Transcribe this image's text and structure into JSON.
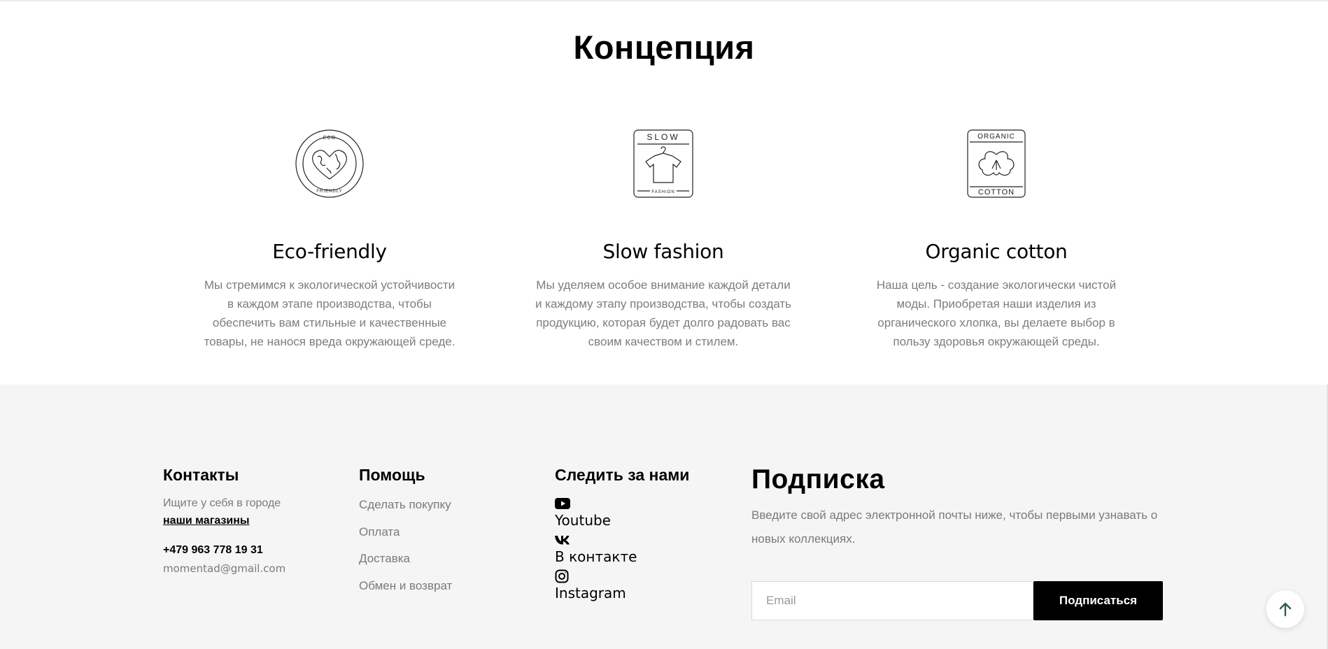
{
  "concept": {
    "title": "Концепция",
    "features": [
      {
        "icon": "eco-friendly-badge",
        "badge_top": "ECO",
        "badge_bottom": "FRIENDLY",
        "title": "Eco-friendly",
        "text": "Мы стремимся к экологической устойчивости в каждом этапе производства, чтобы обеспечить вам стильные и качественные товары, не нанося вреда окружающей среде."
      },
      {
        "icon": "slow-fashion-badge",
        "badge_top": "SLOW",
        "badge_bottom": "FASHION",
        "title": "Slow fashion",
        "text": "Мы уделяем особое внимание каждой детали и каждому этапу производства, чтобы создать продукцию, которая будет долго радовать вас своим качеством и стилем."
      },
      {
        "icon": "organic-cotton-badge",
        "badge_top": "ORGANIC",
        "badge_bottom": "COTTON",
        "title": "Organic cotton",
        "text": "Наша цель - создание экологически чистой моды. Приобретая наши изделия из органического хлопка, вы делаете выбор в пользу здоровья окружающей среды."
      }
    ]
  },
  "footer": {
    "contacts": {
      "title": "Контакты",
      "find_text": "Ищите у себя в городе",
      "stores_link": "наши магазины",
      "phone": "+479 963 778 19 31",
      "email": "momentad@gmail.com"
    },
    "help": {
      "title": "Помощь",
      "links": [
        "Сделать покупку",
        "Оплата",
        "Доставка",
        "Обмен и возврат"
      ]
    },
    "follow": {
      "title": "Следить за нами",
      "links": [
        {
          "icon": "youtube-icon",
          "label": "Youtube"
        },
        {
          "icon": "vk-icon",
          "label": "В контакте"
        },
        {
          "icon": "instagram-icon",
          "label": "Instagram"
        }
      ]
    },
    "subscribe": {
      "title": "Подписка",
      "description": "Введите свой адрес электронной почты ниже, чтобы первыми узнавать о новых коллекциях.",
      "email_placeholder": "Email",
      "button_label": "Подписаться"
    }
  },
  "scroll_to_top": {
    "icon": "arrow-up-icon",
    "color": "#2f5d46"
  }
}
